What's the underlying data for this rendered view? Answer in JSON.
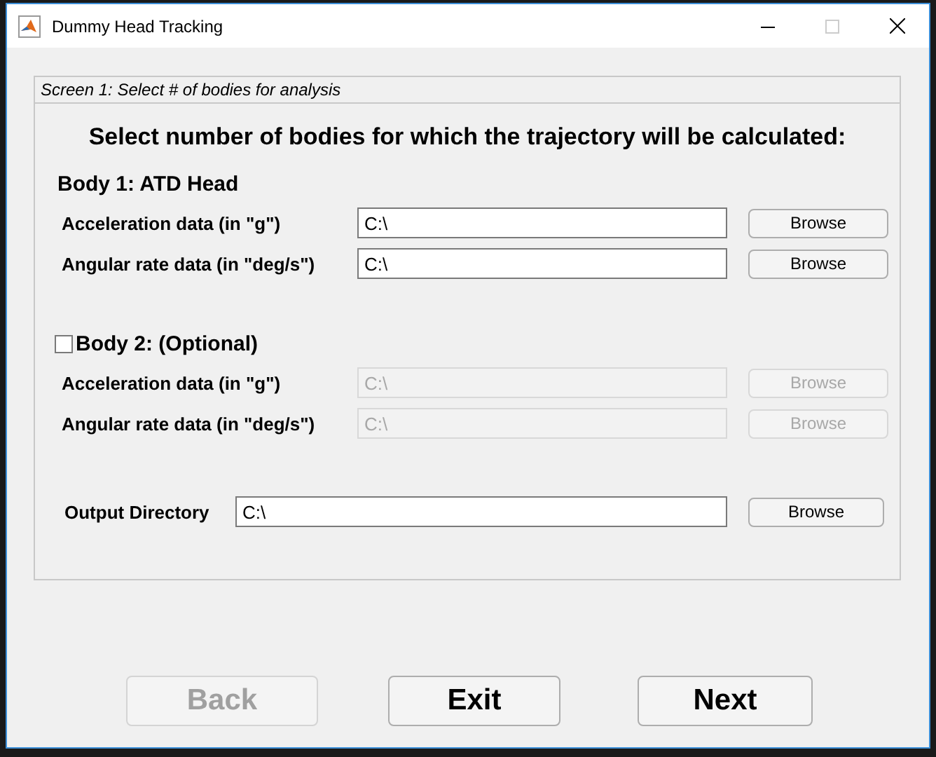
{
  "window": {
    "title": "Dummy Head Tracking"
  },
  "panel": {
    "title": "Screen 1: Select # of bodies for analysis",
    "heading": "Select number of bodies for which the trajectory will be calculated:",
    "bodies": [
      {
        "kind": "fixed",
        "title": "Body 1: ATD Head",
        "fields": [
          {
            "label": "Acceleration data (in \"g\")",
            "value": "C:\\",
            "button": "Browse",
            "disabled": false
          },
          {
            "label": "Angular rate data (in \"deg/s\")",
            "value": "C:\\",
            "button": "Browse",
            "disabled": false
          }
        ]
      },
      {
        "kind": "optional",
        "title": "Body 2: (Optional)",
        "checked": false,
        "fields": [
          {
            "label": "Acceleration data (in \"g\")",
            "value": "C:\\",
            "button": "Browse",
            "disabled": true
          },
          {
            "label": "Angular rate data (in \"deg/s\")",
            "value": "C:\\",
            "button": "Browse",
            "disabled": true
          }
        ]
      }
    ],
    "output": {
      "label": "Output Directory",
      "value": "C:\\",
      "button": "Browse"
    }
  },
  "buttons": [
    {
      "label": "Back",
      "disabled": true
    },
    {
      "label": "Exit",
      "disabled": false
    },
    {
      "label": "Next",
      "disabled": false
    }
  ]
}
